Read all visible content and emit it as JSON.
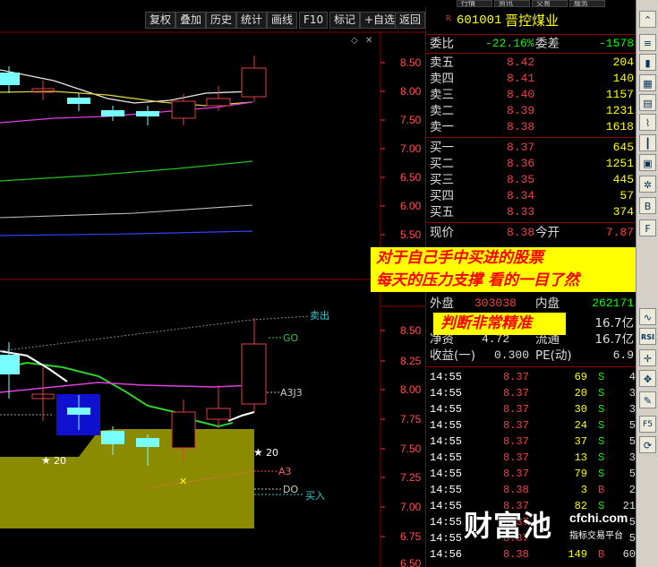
{
  "top_tabs": [
    "行情",
    "资讯",
    "交易",
    "服务"
  ],
  "menu": [
    "复权",
    "叠加",
    "历史",
    "统计",
    "画线",
    "F10",
    "标记",
    "+自选",
    "返回"
  ],
  "stock": {
    "code": "601001",
    "name": "晋控煤业",
    "badge": "R"
  },
  "weibi": {
    "label": "委比",
    "value": "-22.16%",
    "label2": "委差",
    "value2": "-1578"
  },
  "sell": [
    {
      "label": "卖五",
      "price": "8.42",
      "vol": "204"
    },
    {
      "label": "卖四",
      "price": "8.41",
      "vol": "140"
    },
    {
      "label": "卖三",
      "price": "8.40",
      "vol": "1157"
    },
    {
      "label": "卖二",
      "price": "8.39",
      "vol": "1231"
    },
    {
      "label": "卖一",
      "price": "8.38",
      "vol": "1618"
    }
  ],
  "buy": [
    {
      "label": "买一",
      "price": "8.37",
      "vol": "645"
    },
    {
      "label": "买二",
      "price": "8.36",
      "vol": "1251"
    },
    {
      "label": "买三",
      "price": "8.35",
      "vol": "445"
    },
    {
      "label": "买四",
      "price": "8.34",
      "vol": "57"
    },
    {
      "label": "买五",
      "price": "8.33",
      "vol": "374"
    }
  ],
  "quote": {
    "now_label": "现价",
    "now": "8.38",
    "open_label": "今开",
    "open": "7.87",
    "out_label": "外盘",
    "out": "303038",
    "in_label": "内盘",
    "in": "262171",
    "cap1": "16.7亿",
    "cap2": "16.7亿",
    "jingzi_label": "净资",
    "jingzi": "4.72",
    "liutong_label": "流通",
    "shouyi_label": "收益(一)",
    "shouyi": "0.300",
    "pe_label": "PE(动)",
    "pe": "6.9"
  },
  "ticks": [
    {
      "time": "14:55",
      "price": "8.37",
      "vol": "69",
      "side": "S",
      "n": "4"
    },
    {
      "time": "14:55",
      "price": "8.37",
      "vol": "20",
      "side": "S",
      "n": "3"
    },
    {
      "time": "14:55",
      "price": "8.37",
      "vol": "30",
      "side": "S",
      "n": "3"
    },
    {
      "time": "14:55",
      "price": "8.37",
      "vol": "24",
      "side": "S",
      "n": "5"
    },
    {
      "time": "14:55",
      "price": "8.37",
      "vol": "37",
      "side": "S",
      "n": "5"
    },
    {
      "time": "14:55",
      "price": "8.37",
      "vol": "13",
      "side": "S",
      "n": "3"
    },
    {
      "time": "14:55",
      "price": "8.37",
      "vol": "79",
      "side": "S",
      "n": "5"
    },
    {
      "time": "14:55",
      "price": "8.38",
      "vol": "3",
      "side": "B",
      "n": "2"
    },
    {
      "time": "14:55",
      "price": "8.37",
      "vol": "82",
      "side": "S",
      "n": "21"
    },
    {
      "time": "14:55",
      "price": "8.37",
      "vol": "",
      "side": "",
      "n": "5"
    },
    {
      "time": "14:55",
      "price": "8.37",
      "vol": "",
      "side": "",
      "n": "5"
    },
    {
      "time": "14:56",
      "price": "8.38",
      "vol": "149",
      "side": "B",
      "n": "60"
    }
  ],
  "upper_axis": [
    "8.50",
    "8.00",
    "7.50",
    "7.00",
    "6.50",
    "6.00",
    "5.50"
  ],
  "lower_axis": [
    "8.50",
    "8.25",
    "8.00",
    "7.75",
    "7.50",
    "7.25",
    "7.00",
    "6.75",
    "6.50"
  ],
  "annotations": {
    "sell_line": "卖出",
    "go": "GO",
    "a3j3": "A3J3",
    "a3": "A3",
    "do": "DO",
    "buy_line": "买入",
    "star_left": "20",
    "star_right": "20"
  },
  "overlay": {
    "line1": "对于自己手中买进的股票",
    "line2": "每天的压力支撑 看的一目了然",
    "line3": "判断非常精准"
  },
  "watermark": {
    "text": "财富池",
    "site": "cfchi.com",
    "sub": "指标交易平台"
  },
  "sidebar_icons": [
    "up-icon",
    "list-icon",
    "bar-icon",
    "grid-icon",
    "table-icon",
    "chart-icon",
    "candle-icon",
    "book-icon",
    "sun-icon",
    "b-icon",
    "f-icon",
    "wave-icon",
    "rsi-icon",
    "cross-icon",
    "pen-icon",
    "f5-icon",
    "refresh-icon"
  ],
  "sidebar_labels": [
    "RSI",
    "F5"
  ]
}
